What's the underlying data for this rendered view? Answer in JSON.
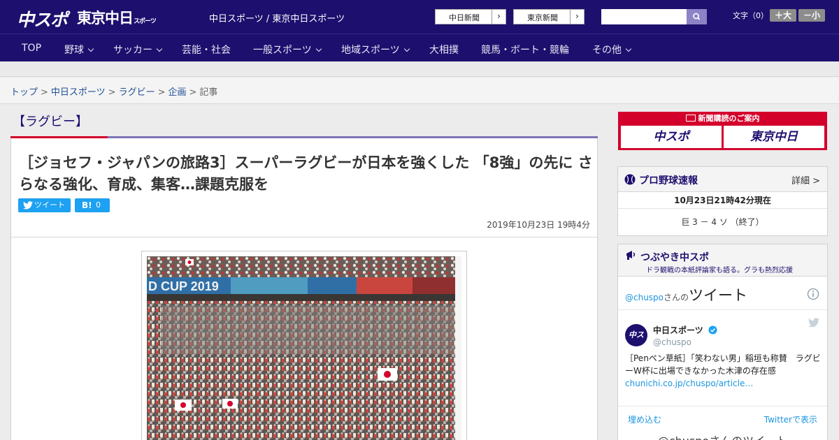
{
  "header": {
    "logo_chuspo": "中スポ",
    "logo_tokyo": "東京中日",
    "logo_tokyo_small": "スポーツ",
    "site_names": "中日スポーツ / 東京中日スポーツ",
    "ext_links": [
      {
        "label": "中日新聞",
        "arrow": "›"
      },
      {
        "label": "東京新聞",
        "arrow": "›"
      }
    ],
    "search_placeholder": "",
    "font_size_label": "文字（0）",
    "font_bigger": "＋大",
    "font_smaller": "－小"
  },
  "nav": [
    {
      "label": "TOP",
      "dropdown": false
    },
    {
      "label": "野球",
      "dropdown": true
    },
    {
      "label": "サッカー",
      "dropdown": true
    },
    {
      "label": "芸能・社会",
      "dropdown": false
    },
    {
      "label": "一般スポーツ",
      "dropdown": true
    },
    {
      "label": "地域スポーツ",
      "dropdown": true
    },
    {
      "label": "大相撲",
      "dropdown": false
    },
    {
      "label": "競馬・ボート・競輪",
      "dropdown": false
    },
    {
      "label": "その他",
      "dropdown": true
    }
  ],
  "breadcrumb": [
    "トップ",
    "中日スポーツ",
    "ラグビー",
    "企画",
    "記事"
  ],
  "article": {
    "category": "【ラグビー】",
    "headline": "［ジョセフ・ジャパンの旅路3］スーパーラグビーが日本を強くした 「8強」の先に さらなる強化、育成、集客…課題克服を",
    "tweet_label": "ツイート",
    "hatena_label": "B!",
    "hatena_count": "0",
    "date": "2019年10月23日 19時4分",
    "photo_banner": "D CUP 2019"
  },
  "sidebar": {
    "promo_title": "新聞購読のご案内",
    "promo_logos": [
      "中スポ",
      "東京中日"
    ],
    "baseball": {
      "title": "プロ野球速報",
      "detail": "詳細 >",
      "time": "10月23日21時42分現在",
      "score": "巨 3 － 4 ソ （終了）"
    },
    "twitter": {
      "title": "つぶやき中スポ",
      "subtitle": "ドラ観戦の本紙評論家も語る。グラも熱烈応援",
      "account": "@chuspo",
      "account_suffix": "さんの",
      "tweets_word": "ツイート",
      "user_name": "中日スポーツ",
      "user_handle": "@chuspo",
      "tweet_text": "［Penペン草紙］「笑わない男」稲垣も称賛　ラグビーW杯に出場できなかった木津の存在感",
      "tweet_link": "chunichi.co.jp/chuspo/article…",
      "embed": "埋め込む",
      "view_on_twitter": "Twitterで表示",
      "footer": "@chuspoさんのツイート"
    }
  },
  "colors": {
    "brand_navy": "#1d0f6e",
    "accent_red": "#d3002b",
    "accent_purple": "#7d73b7",
    "twitter_blue": "#1da1f2"
  }
}
